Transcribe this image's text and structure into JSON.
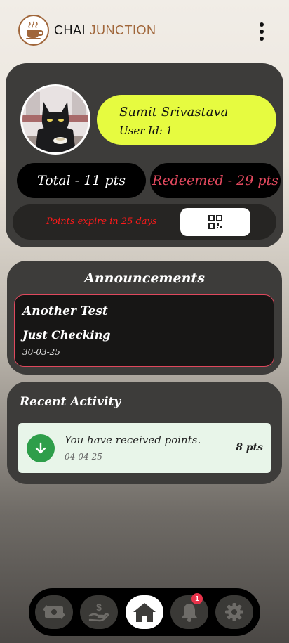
{
  "header": {
    "brand_part1": "CHAI",
    "brand_part2": "JUNCTION",
    "logo_icon": "coffee-cup-icon",
    "menu_icon": "kebab-menu-icon"
  },
  "profile": {
    "name": "Sumit Srivastava",
    "user_id": "User Id: 1",
    "total": "Total - 11 pts",
    "redeemed": "Redeemed - 29 pts",
    "expiry_notice": "Points expire in 25 days",
    "qr_icon": "qr-code-icon"
  },
  "announcements": {
    "title": "Announcements",
    "items": [
      {
        "heading": "Another Test",
        "body": "Just Checking",
        "date": "30-03-25"
      }
    ]
  },
  "recent_activity": {
    "title": "Recent Activity",
    "items": [
      {
        "text": "You have received points.",
        "date": "04-04-25",
        "points": "8 pts",
        "icon": "arrow-down-icon"
      }
    ]
  },
  "nav": {
    "items": [
      {
        "icon": "money-exchange-icon"
      },
      {
        "icon": "hand-dollar-icon"
      },
      {
        "icon": "home-icon"
      },
      {
        "icon": "bell-icon",
        "badge": "1"
      },
      {
        "icon": "gear-icon"
      }
    ]
  },
  "colors": {
    "accent_yellow": "#e6fb40",
    "redeemed_red": "#e0485d",
    "expiry_red": "#ff1a1a",
    "brand_brown": "#a0663a",
    "activity_green": "#2e9e4a",
    "card_dark": "#3d3c3a"
  }
}
